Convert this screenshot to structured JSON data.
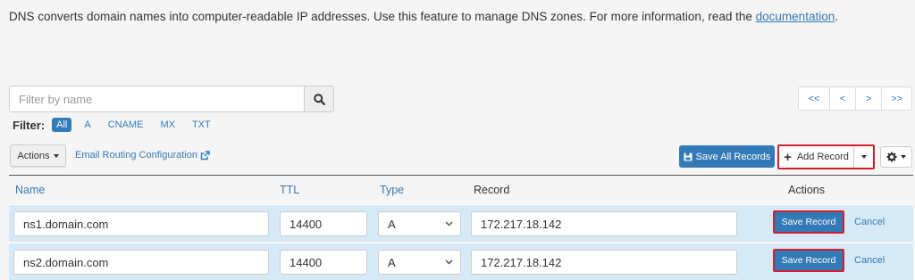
{
  "intro": {
    "text": "DNS converts domain names into computer-readable IP addresses. Use this feature to manage DNS zones. For more information, read the ",
    "link": "documentation",
    "suffix": "."
  },
  "search": {
    "placeholder": "Filter by name"
  },
  "pager": [
    "<<",
    "<",
    ">",
    ">>"
  ],
  "filter": {
    "label": "Filter:",
    "options": [
      "All",
      "A",
      "CNAME",
      "MX",
      "TXT"
    ],
    "active": "All"
  },
  "toolbar": {
    "actions_label": "Actions",
    "email_routing_label": "Email Routing Configuration",
    "save_all_label": "Save All Records",
    "add_record_label": "Add Record"
  },
  "table": {
    "headers": {
      "name": "Name",
      "ttl": "TTL",
      "type": "Type",
      "record": "Record",
      "actions": "Actions"
    },
    "rows": [
      {
        "name": "ns1.domain.com",
        "ttl": "14400",
        "type": "A",
        "record": "172.217.18.142",
        "save_label": "Save Record",
        "cancel_label": "Cancel"
      },
      {
        "name": "ns2.domain.com",
        "ttl": "14400",
        "type": "A",
        "record": "172.217.18.142",
        "save_label": "Save Record",
        "cancel_label": "Cancel"
      }
    ]
  },
  "colors": {
    "link": "#337ab7",
    "highlight": "#d0202e",
    "row_bg": "#d6e9f6"
  }
}
